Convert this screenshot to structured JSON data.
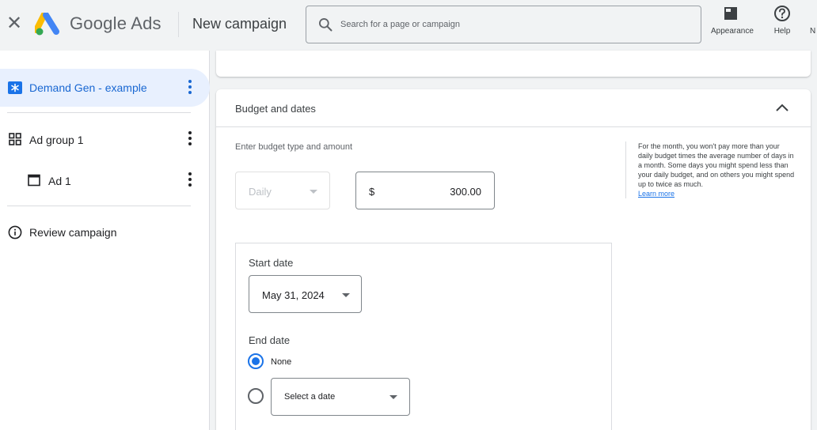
{
  "header": {
    "close_symbol": "✕",
    "product_name": "Google Ads",
    "page_title": "New campaign",
    "search_placeholder": "Search for a page or campaign",
    "appearance_label": "Appearance",
    "help_label": "Help",
    "notifications_label_partial": "N"
  },
  "sidebar": {
    "items": [
      {
        "label": "Demand Gen - example",
        "icon": "campaign-star-icon"
      },
      {
        "label": "Ad group 1",
        "icon": "grid-icon"
      },
      {
        "label": "Ad 1",
        "icon": "ad-window-icon"
      },
      {
        "label": "Review campaign",
        "icon": "info-icon"
      }
    ]
  },
  "budget": {
    "section_title": "Budget and dates",
    "type_label": "Enter budget type and amount",
    "type_value": "Daily",
    "currency": "$",
    "amount": "300.00",
    "help_text": "For the month, you won't pay more than your daily budget times the average number of days in a month. Some days you might spend less than your daily budget, and on others you might spend up to twice as much.",
    "help_link": "Learn more"
  },
  "dates": {
    "start_label": "Start date",
    "start_value": "May 31, 2024",
    "end_label": "End date",
    "none_label": "None",
    "select_placeholder": "Select a date"
  },
  "colors": {
    "accent": "#1a73e8",
    "active_bg": "#e8f0fe",
    "header_bg": "#f1f3f4"
  }
}
